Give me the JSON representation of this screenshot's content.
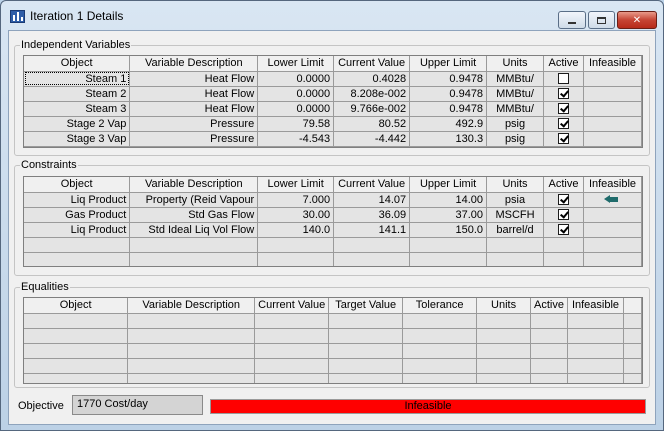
{
  "window": {
    "title": "Iteration 1 Details"
  },
  "independent": {
    "legend": "Independent Variables",
    "columns": [
      "Object",
      "Variable Description",
      "Lower Limit",
      "Current Value",
      "Upper Limit",
      "Units",
      "Active",
      "Infeasible"
    ],
    "rows": [
      {
        "object": "Steam 1",
        "description": "Heat Flow",
        "lower": "0.0000",
        "current": "0.4028",
        "upper": "0.9478",
        "units": "MMBtu/",
        "active": false,
        "infeasible": ""
      },
      {
        "object": "Steam 2",
        "description": "Heat Flow",
        "lower": "0.0000",
        "current": "8.208e-002",
        "upper": "0.9478",
        "units": "MMBtu/",
        "active": true,
        "infeasible": ""
      },
      {
        "object": "Steam 3",
        "description": "Heat Flow",
        "lower": "0.0000",
        "current": "9.766e-002",
        "upper": "0.9478",
        "units": "MMBtu/",
        "active": true,
        "infeasible": ""
      },
      {
        "object": "Stage 2 Vap",
        "description": "Pressure",
        "lower": "79.58",
        "current": "80.52",
        "upper": "492.9",
        "units": "psig",
        "active": true,
        "infeasible": ""
      },
      {
        "object": "Stage 3 Vap",
        "description": "Pressure",
        "lower": "-4.543",
        "current": "-4.442",
        "upper": "130.3",
        "units": "psig",
        "active": true,
        "infeasible": ""
      }
    ]
  },
  "constraints": {
    "legend": "Constraints",
    "columns": [
      "Object",
      "Variable Description",
      "Lower Limit",
      "Current Value",
      "Upper Limit",
      "Units",
      "Active",
      "Infeasible"
    ],
    "rows": [
      {
        "object": "Liq Product",
        "description": "Property (Reid Vapour",
        "lower": "7.000",
        "current": "14.07",
        "upper": "14.00",
        "units": "psia",
        "active": true,
        "infeasible_icon": "arrow-left-icon"
      },
      {
        "object": "Gas Product",
        "description": "Std Gas Flow",
        "lower": "30.00",
        "current": "36.09",
        "upper": "37.00",
        "units": "MSCFH",
        "active": true,
        "infeasible_icon": ""
      },
      {
        "object": "Liq Product",
        "description": "Std Ideal Liq Vol Flow",
        "lower": "140.0",
        "current": "141.1",
        "upper": "150.0",
        "units": "barrel/d",
        "active": true,
        "infeasible_icon": ""
      }
    ]
  },
  "equalities": {
    "legend": "Equalities",
    "columns": [
      "Object",
      "Variable Description",
      "Current Value",
      "Target Value",
      "Tolerance",
      "Units",
      "Active",
      "Infeasible"
    ]
  },
  "footer": {
    "objective_label": "Objective",
    "objective_value": "1770 Cost/day",
    "status_text": "Infeasible",
    "status_color": "#ff0000"
  }
}
